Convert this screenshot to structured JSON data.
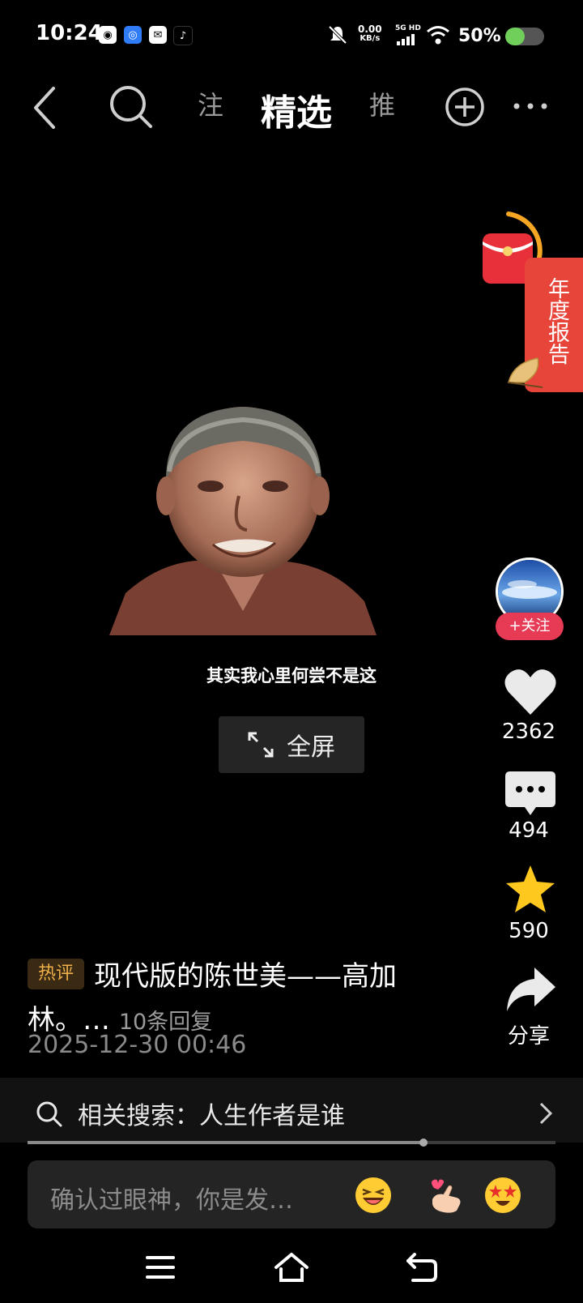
{
  "status_bar": {
    "time": "10:24",
    "net_speed_value": "0.00",
    "net_speed_unit": "KB/s",
    "network_type": "5G HD",
    "battery_text": "50%",
    "battery_level": 0.5
  },
  "top_nav": {
    "tabs": [
      "注",
      "精选",
      "推"
    ],
    "selected_tab": "精选"
  },
  "annual_report": {
    "label": "年度报告"
  },
  "video": {
    "subtitle": "其实我心里何尝不是这"
  },
  "fullscreen": {
    "label": "全屏"
  },
  "rail": {
    "follow_label": "+关注",
    "likes": "2362",
    "comments": "494",
    "favorites": "590",
    "share_label": "分享"
  },
  "hot_comment": {
    "tag": "热评",
    "text": "现代版的陈世美——高加林。…",
    "replies": "10条回复",
    "time": "2025-12-30 00:46"
  },
  "related_search": {
    "label": "相关搜索：人生作者是谁"
  },
  "playback": {
    "progress": 0.75
  },
  "comment_input": {
    "placeholder": "确认过眼神，你是发…"
  },
  "colors": {
    "accent_red": "#e63a55",
    "star_yellow": "#ffc81e",
    "hot_tag_text": "#f0b04a"
  }
}
